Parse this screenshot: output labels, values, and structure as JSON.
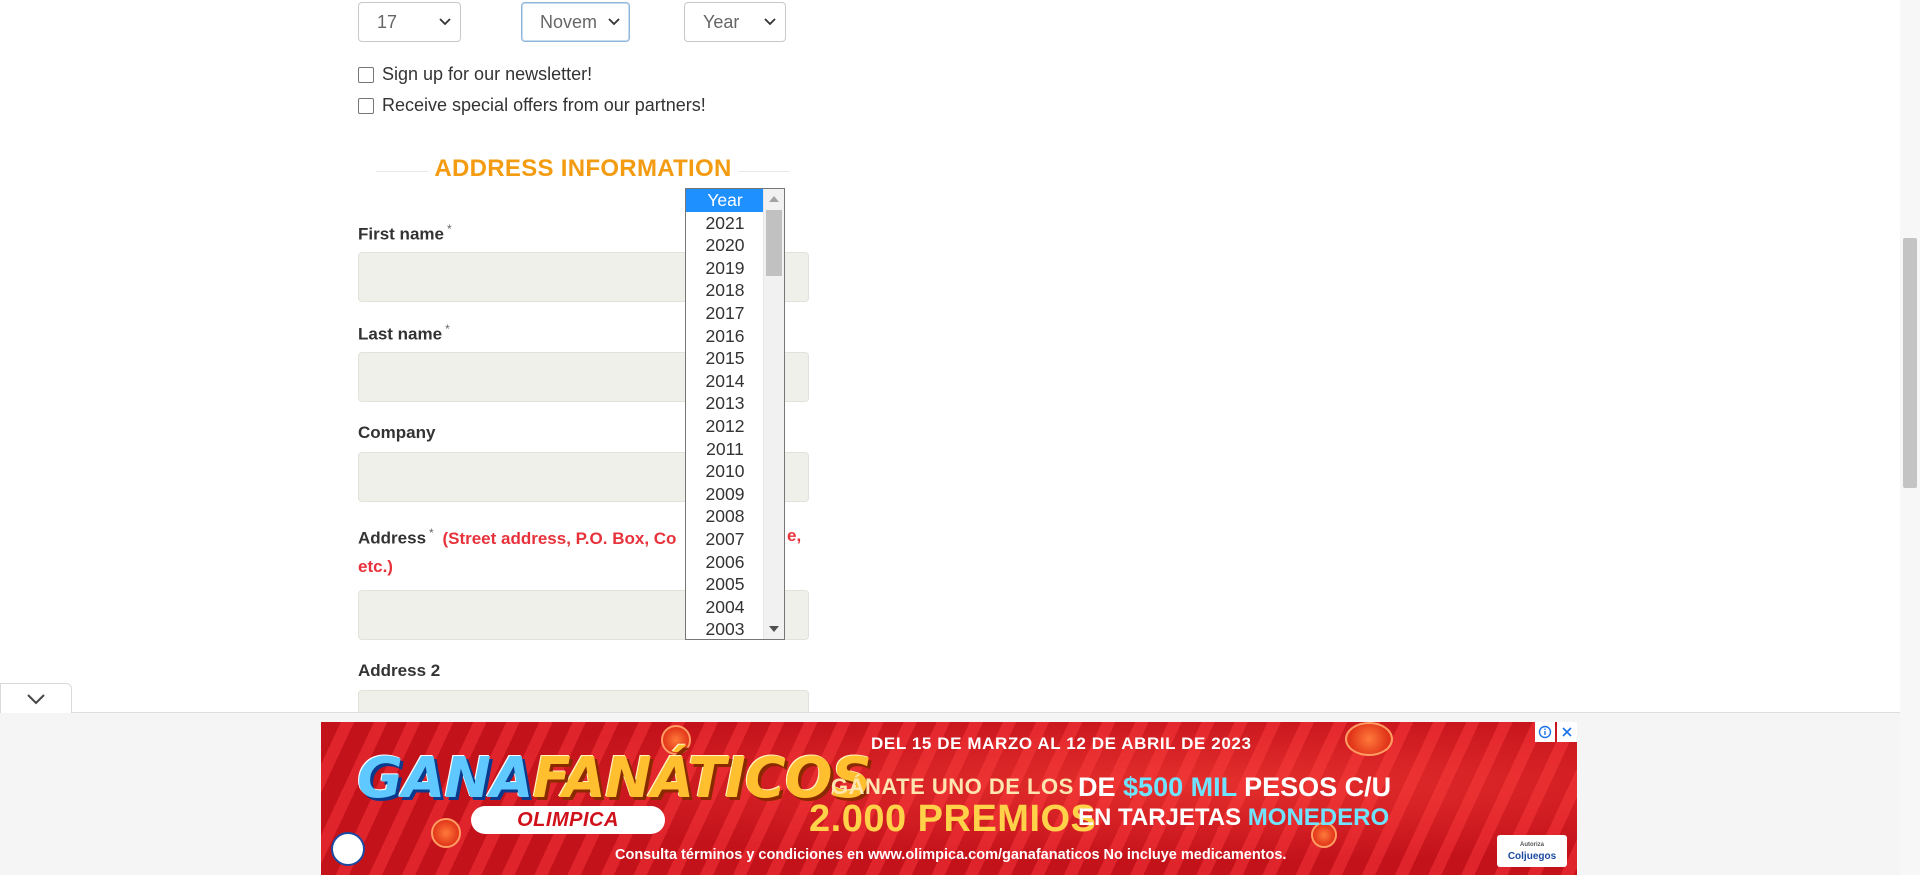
{
  "birthdate": {
    "day": "17",
    "month": "Novem",
    "year": "Year"
  },
  "checkboxes": {
    "newsletter": "Sign up for our newsletter!",
    "offers": "Receive special offers from our partners!"
  },
  "section_title": "ADDRESS INFORMATION",
  "fields": {
    "first_name": "First name",
    "last_name": "Last name",
    "company": "Company",
    "address": "Address",
    "address_hint": "(Street address, P.O. Box, Co",
    "address_hint_tail": "e,",
    "address_hint_end": "etc.)",
    "address2": "Address 2",
    "required_mark": "*"
  },
  "year_dropdown": {
    "options": [
      "Year",
      "2021",
      "2020",
      "2019",
      "2018",
      "2017",
      "2016",
      "2015",
      "2014",
      "2013",
      "2012",
      "2011",
      "2010",
      "2009",
      "2008",
      "2007",
      "2006",
      "2005",
      "2004",
      "2003"
    ],
    "selected": "Year"
  },
  "ad": {
    "logo_left": "GANA",
    "logo_right": "FANÁTICOS",
    "brand": "OLIMPICA",
    "dates": "DEL 15 DE MARZO AL 12 DE ABRIL DE 2023",
    "win_line1": "GÁNATE UNO DE LOS",
    "win_line2": "2.000 PREMIOS",
    "promo_line1_a": "DE",
    "promo_line1_b": "$500 MIL",
    "promo_line1_c": "PESOS C/U",
    "promo_line2_a": "EN TARJETAS",
    "promo_line2_b": "MONEDERO",
    "terms": "Consulta términos y condiciones en www.olimpica.com/ganafanaticos No incluye medicamentos.",
    "regulator_top": "Autoriza",
    "regulator": "Coljuegos"
  },
  "colors": {
    "accent_orange": "#f39c12",
    "hint_red": "#e7323c",
    "dropdown_selected": "#1e90ff"
  }
}
